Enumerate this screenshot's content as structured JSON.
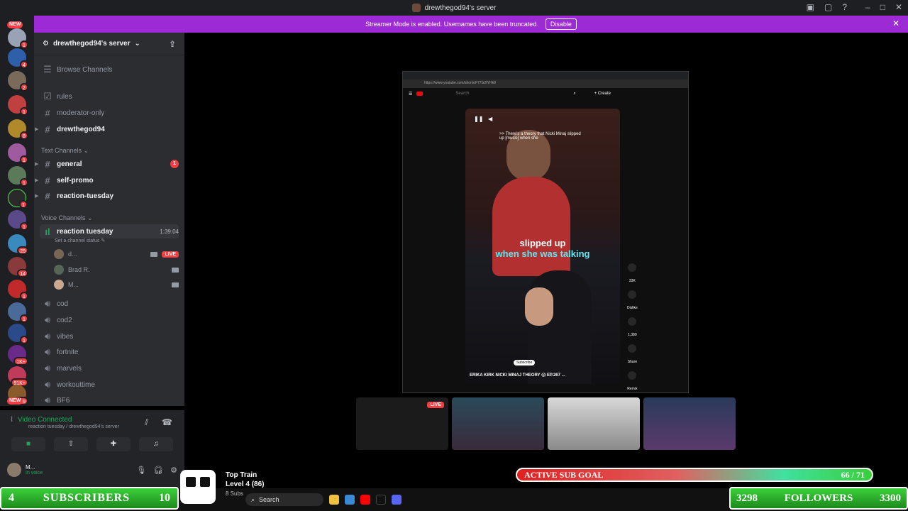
{
  "window": {
    "title": "drewthegod94's server"
  },
  "banner": {
    "text": "Streamer Mode is enabled. Usernames have been truncated.",
    "button": "Disable"
  },
  "server_badges": [
    "1",
    "4",
    "2",
    "1",
    "8",
    "1",
    "1",
    "1",
    "1",
    "29",
    "14",
    "1",
    "1",
    "1",
    "1K+",
    "91K+",
    "199"
  ],
  "server_new_label": "NEW",
  "server": {
    "name": "drewthegod94's server",
    "browse": "Browse Channels",
    "top_channels": [
      "rules",
      "moderator-only",
      "drewthegod94"
    ],
    "text_category": "Text Channels",
    "text_channels": [
      {
        "name": "general",
        "unread": "1"
      },
      {
        "name": "self-promo"
      },
      {
        "name": "reaction-tuesday"
      }
    ],
    "voice_category": "Voice Channels",
    "active_voice": {
      "name": "reaction tuesday",
      "timer": "1:39:04",
      "status": "Set a channel status"
    },
    "voice_users": [
      {
        "name": "d...",
        "live": "LIVE"
      },
      {
        "name": "Brad R."
      },
      {
        "name": "M..."
      }
    ],
    "voice_channels": [
      "cod",
      "cod2",
      "vibes",
      "fortnite",
      "marvels",
      "workouttime",
      "BF6"
    ]
  },
  "voice_panel": {
    "status": "Video Connected",
    "sub": "reaction tuesday / drewthegod94's server",
    "user_name": "M...",
    "user_status": "In voice"
  },
  "browser": {
    "address": "https://www.youtube.com/shorts/F77fs2fYHk8",
    "search_placeholder": "Search",
    "create": "+ Create",
    "top_caption": ">> There's a theory that Nicki Minaj slipped up [music] when she",
    "caption_line1": "slipped up",
    "caption_line2": "when she was talking",
    "subscribe": "Subscribe",
    "video_title": "ERIKA KIRK NICKI MINAJ THEORY 😱 EP.267 ...",
    "actions": [
      {
        "count": "33K"
      },
      {
        "count": "Dislike"
      },
      {
        "count": "1,389"
      },
      {
        "count": "Share"
      },
      {
        "count": "Remix"
      }
    ]
  },
  "stream_tiles": {
    "live": "LIVE"
  },
  "overlay": {
    "subscribers_label": "SUBSCRIBERS",
    "subscribers_current": "4",
    "subscribers_goal": "10",
    "followers_label": "FOLLOWERS",
    "followers_current": "3298",
    "followers_goal": "3300",
    "goal_label": "ACTIVE SUB GOAL",
    "goal_count": "66 / 71",
    "goal_progress": 0.93,
    "train_title": "Top Train",
    "train_level": "Level 4 (86)",
    "train_sub": "8 Subs"
  },
  "taskbar": {
    "search": "Search"
  },
  "colors": {
    "accent": "#9c2bd6",
    "live": "#f23f43",
    "online": "#23a55a",
    "sidebar": "#2b2d31",
    "rail": "#1e1f22"
  }
}
